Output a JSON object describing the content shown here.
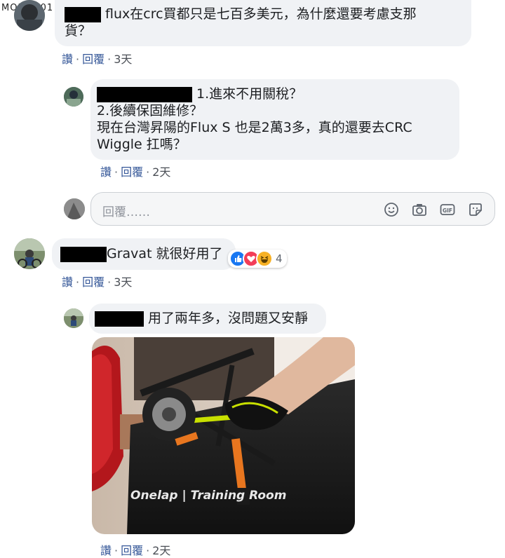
{
  "watermark": {
    "text": "MOBILE01"
  },
  "comment1": {
    "text_line1": "flux在crc買都只是七百多美元，為什麼還要考慮支那",
    "text_line2": "貨？",
    "actions": {
      "like": "讚",
      "reply": "回覆",
      "time": "3天"
    }
  },
  "reply1": {
    "text_line1": "1.進來不用關稅？",
    "text_line2": "2.後續保固維修？",
    "text_line3": "現在台灣昇陽的Flux S 也是2萬3多，真的還要去CRC",
    "text_line4": "Wiggle 扛嗎？",
    "actions": {
      "like": "讚",
      "reply": "回覆",
      "time": "2天"
    }
  },
  "reply_box": {
    "placeholder": "回覆……"
  },
  "comment2": {
    "text": "Gravat 就很好用了",
    "reactions": {
      "count": "4",
      "types": [
        "like-icon",
        "love-icon",
        "haha-icon"
      ]
    },
    "actions": {
      "like": "讚",
      "reply": "回覆",
      "time": "3天"
    }
  },
  "reply2": {
    "text": "用了兩年多，沒問題又安靜",
    "photo_caption": "Onelap | Training Room",
    "actions": {
      "like": "讚",
      "reply": "回覆",
      "time": "2天"
    }
  },
  "colors": {
    "link": "#365899",
    "bubble": "#f0f2f5",
    "like_blue": "#1877f2",
    "love_red": "#f33e58",
    "haha_yellow": "#f7b125",
    "trainer_orange": "#e8761f"
  }
}
